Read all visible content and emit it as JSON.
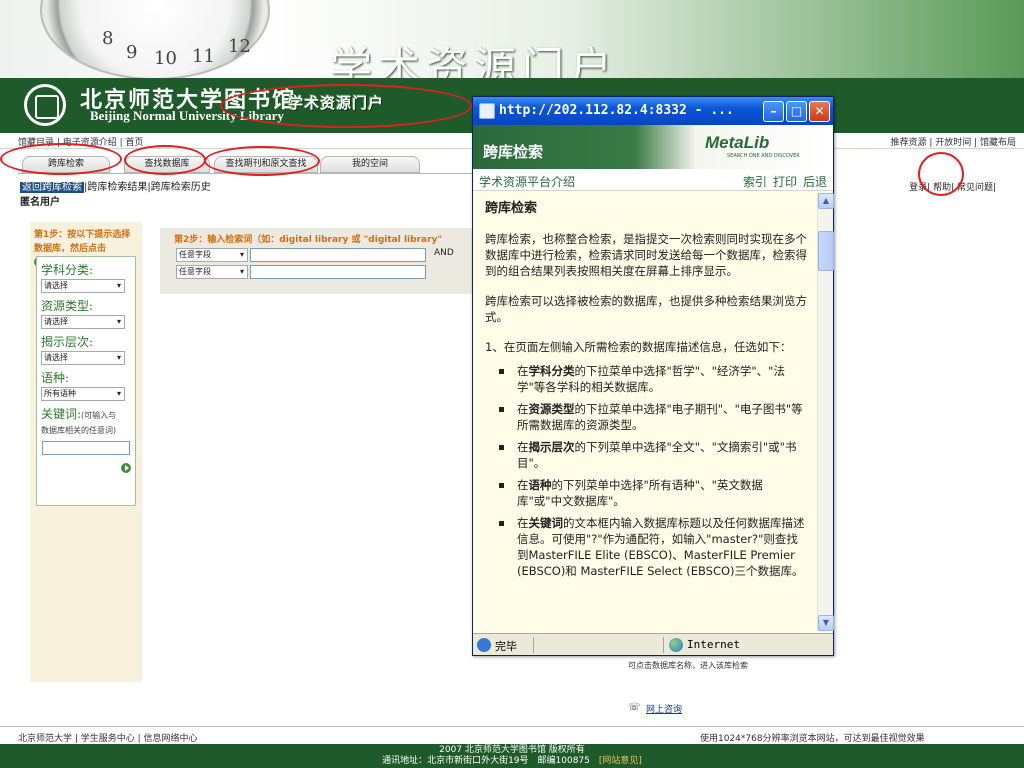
{
  "slide": {
    "title": "学术资源门户",
    "watch_numbers": [
      "8",
      "9",
      "10",
      "11",
      "12"
    ]
  },
  "library": {
    "name_cn": "北京师范大学图书馆",
    "name_en": "Beijing Normal University Library",
    "portal": "学术资源门户"
  },
  "topbar": {
    "left": "馆藏目录 | 电子资源介绍 | 首页",
    "right": "推荐资源 | 开放时间 | 馆藏布局"
  },
  "tabs": [
    "跨库检索",
    "查找数据库",
    "查找期刊和原文查找",
    "我的空间"
  ],
  "subnav": {
    "active": "返回跨库检索",
    "items": [
      "|跨库检索结果",
      "|跨库检索历史"
    ]
  },
  "user_label": "匿名用户",
  "login_links": "登录| 帮助| 常见问题|",
  "left_panel": {
    "step1_line1": "第1步：按以下提示选择",
    "step1_line2": "数据库，然后点击",
    "step1_dot": "。",
    "subject_label": "学科分类:",
    "subject_value": "请选择",
    "type_label": "资源类型:",
    "type_value": "请选择",
    "level_label": "揭示层次:",
    "level_value": "请选择",
    "lang_label": "语种:",
    "lang_value": "所有语种",
    "keyword_label": "关键词:",
    "keyword_small": "(可输入与",
    "keyword_hint": "数据库相关的任意词)"
  },
  "step2": {
    "title": "第2步：输入检索词（如：digital library 或 \"digital library\"",
    "field1": "任意字段",
    "field2": "任意字段",
    "operator": "AND"
  },
  "right_hint": "可点击数据库名称，进入该库检索",
  "ask_link": "网上咨询",
  "footer": {
    "left": "北京师范大学 | 学生服务中心 | 信息网络中心",
    "right": "使用1024*768分辨率浏览本网站，可达到最佳视觉效果",
    "line1": "2007 北京师范大学图书馆 版权所有",
    "line2_prefix": "通讯地址：北京市新街口外大街19号　邮编100875　",
    "line2_link": "[网站意见]"
  },
  "popup": {
    "url": "http://202.112.82.4:8332 - ...",
    "header_title": "跨库检索",
    "brand": "MetaLib",
    "brand_sub": "SEARCH ONE AND DISCOVER",
    "nav_left": "学术资源平台介绍",
    "nav_index": "索引",
    "nav_print": "打印",
    "nav_back": "后退",
    "heading": "跨库检索",
    "para1": "跨库检索，也称整合检索，是指提交一次检索则同时实现在多个数据库中进行检索，检索请求同时发送给每一个数据库，检索得到的组合结果列表按照相关度在屏幕上排序显示。",
    "para2": "跨库检索可以选择被检索的数据库，也提供多种检索结果浏览方式。",
    "para3": "1、在页面左侧输入所需检索的数据库描述信息，任选如下：",
    "items": [
      {
        "pre": "在",
        "b": "学科分类",
        "post": "的下拉菜单中选择\"哲学\"、\"经济学\"、\"法学\"等各学科的相关数据库。"
      },
      {
        "pre": "在",
        "b": "资源类型",
        "post": "的下拉菜单中选择\"电子期刊\"、\"电子图书\"等所需数据库的资源类型。"
      },
      {
        "pre": "在",
        "b": "揭示层次",
        "post": "的下列菜单中选择\"全文\"、\"文摘索引\"或\"书目\"。"
      },
      {
        "pre": "在",
        "b": "语种",
        "post": "的下列菜单中选择\"所有语种\"、\"英文数据库\"或\"中文数据库\"。"
      },
      {
        "pre": "在",
        "b": "关键词",
        "post": "的文本框内输入数据库标题以及任何数据库描述信息。可使用\"?\"作为通配符，如输入\"master?\"则查找到MasterFILE Elite (EBSCO)、MasterFILE Premier (EBSCO)和 MasterFILE Select (EBSCO)三个数据库。"
      }
    ],
    "status_done": "完毕",
    "status_zone": "Internet"
  },
  "colors": {
    "banner_green": "#1e5a2a",
    "annotation_red": "#e02020",
    "step_orange": "#d07010",
    "xp_blue": "#0a56d8"
  }
}
